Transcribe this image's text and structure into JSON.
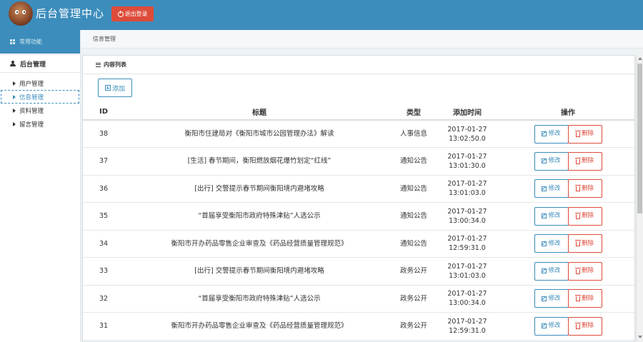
{
  "header": {
    "title": "后台管理中心",
    "logout_label": "退出登录",
    "colors": {
      "bar": "#3c8dbc",
      "logout": "#dd4b39"
    }
  },
  "sidebar": {
    "top_label": "常用功能",
    "group_label": "后台管理",
    "items": [
      {
        "label": "用户管理",
        "active": false
      },
      {
        "label": "信息管理",
        "active": true
      },
      {
        "label": "资料管理",
        "active": false
      },
      {
        "label": "留言管理",
        "active": false
      }
    ]
  },
  "breadcrumb": {
    "label": "信息管理"
  },
  "panel": {
    "title": "内容列表",
    "add_label": "添加"
  },
  "table": {
    "headers": {
      "id": "ID",
      "title": "标题",
      "type": "类型",
      "time": "添加时间",
      "ops": "操作"
    },
    "edit_label": "修改",
    "delete_label": "删除",
    "rows": [
      {
        "id": "38",
        "title": "衡阳市住建局对《衡阳市城市公园管理办法》解读",
        "type": "人事信息",
        "date": "2017-01-27",
        "time": "13:02:50.0"
      },
      {
        "id": "37",
        "title": "[生活] 春节期间，衡阳燃放烟花爆竹划定“红线”",
        "type": "通知公告",
        "date": "2017-01-27",
        "time": "13:01:30.0"
      },
      {
        "id": "36",
        "title": "[出行] 交警提示春节期间衡阳境内避堵攻略",
        "type": "通知公告",
        "date": "2017-01-27",
        "time": "13:01:03.0"
      },
      {
        "id": "35",
        "title": "“首届享受衡阳市政府特殊津贴”人选公示",
        "type": "通知公告",
        "date": "2017-01-27",
        "time": "13:00:34.0"
      },
      {
        "id": "34",
        "title": "衡阳市开办药品零售企业审查及《药品经营质量管理规范》",
        "type": "通知公告",
        "date": "2017-01-27",
        "time": "12:59:31.0"
      },
      {
        "id": "33",
        "title": "[出行] 交警提示春节期间衡阳境内避堵攻略",
        "type": "政务公开",
        "date": "2017-01-27",
        "time": "13:01:03.0"
      },
      {
        "id": "32",
        "title": "“首届享受衡阳市政府特殊津贴”人选公示",
        "type": "政务公开",
        "date": "2017-01-27",
        "time": "13:00:34.0"
      },
      {
        "id": "31",
        "title": "衡阳市开办药品零售企业审查及《药品经营质量管理规范》",
        "type": "政务公开",
        "date": "2017-01-27",
        "time": "12:59:31.0"
      }
    ]
  }
}
